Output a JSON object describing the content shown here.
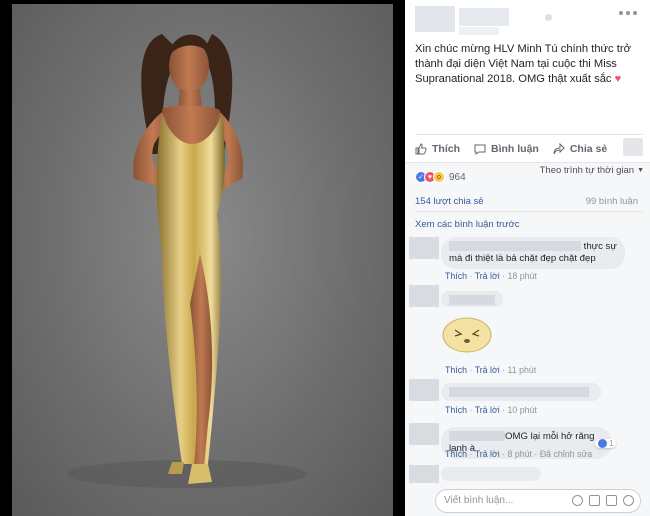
{
  "post": {
    "text": "Xin chúc mừng HLV Minh Tú chính thức trở thành đại diện Việt Nam tại cuộc thi Miss Supranational 2018. OMG thật xuất sắc",
    "heart": "♥"
  },
  "actions": {
    "like": "Thích",
    "comment": "Bình luận",
    "share": "Chia sẻ"
  },
  "reactions": {
    "count": "964",
    "sort": "Theo trình tự thời gian"
  },
  "stats": {
    "shares": "154 lượt chia sẻ",
    "comments": "99 bình luận"
  },
  "view_previous": "Xem các bình luận trước",
  "comments": [
    {
      "text_line1": "thực sự",
      "text_line2": "mà đi thiệt là bả chặt đẹp chặt đẹp",
      "like": "Thích",
      "reply": "Trả lời",
      "time": "18 phút"
    },
    {
      "like": "Thích",
      "reply": "Trả lời",
      "time": "11 phút"
    },
    {
      "like": "Thích",
      "reply": "Trả lời",
      "time": "10 phút"
    },
    {
      "text": "OMG lại mỗi hở răng lạnh à",
      "like": "Thích",
      "reply": "Trả lời",
      "time": "8 phút",
      "edited": "Đã chỉnh sửa",
      "like_count": "1"
    }
  ],
  "reply": {
    "placeholder": "Viết bình luận..."
  },
  "colors": {
    "link": "#385898",
    "gold": "#c9a84c",
    "heart": "#f5526f"
  }
}
